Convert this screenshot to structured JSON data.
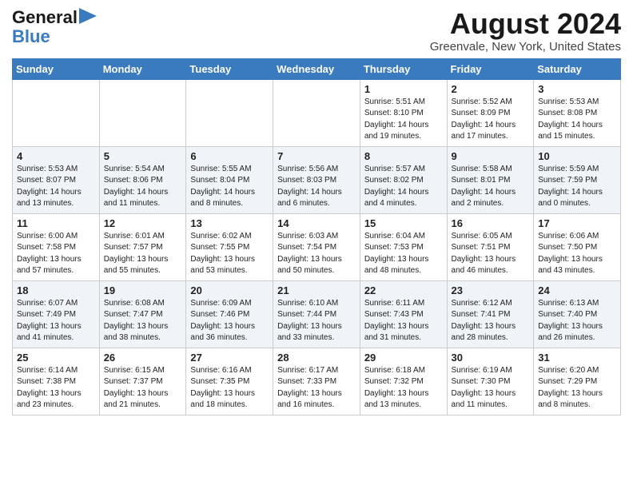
{
  "header": {
    "logo_line1": "General",
    "logo_line2": "Blue",
    "month_year": "August 2024",
    "location": "Greenvale, New York, United States"
  },
  "weekdays": [
    "Sunday",
    "Monday",
    "Tuesday",
    "Wednesday",
    "Thursday",
    "Friday",
    "Saturday"
  ],
  "weeks": [
    [
      {
        "day": "",
        "info": ""
      },
      {
        "day": "",
        "info": ""
      },
      {
        "day": "",
        "info": ""
      },
      {
        "day": "",
        "info": ""
      },
      {
        "day": "1",
        "info": "Sunrise: 5:51 AM\nSunset: 8:10 PM\nDaylight: 14 hours\nand 19 minutes."
      },
      {
        "day": "2",
        "info": "Sunrise: 5:52 AM\nSunset: 8:09 PM\nDaylight: 14 hours\nand 17 minutes."
      },
      {
        "day": "3",
        "info": "Sunrise: 5:53 AM\nSunset: 8:08 PM\nDaylight: 14 hours\nand 15 minutes."
      }
    ],
    [
      {
        "day": "4",
        "info": "Sunrise: 5:53 AM\nSunset: 8:07 PM\nDaylight: 14 hours\nand 13 minutes."
      },
      {
        "day": "5",
        "info": "Sunrise: 5:54 AM\nSunset: 8:06 PM\nDaylight: 14 hours\nand 11 minutes."
      },
      {
        "day": "6",
        "info": "Sunrise: 5:55 AM\nSunset: 8:04 PM\nDaylight: 14 hours\nand 8 minutes."
      },
      {
        "day": "7",
        "info": "Sunrise: 5:56 AM\nSunset: 8:03 PM\nDaylight: 14 hours\nand 6 minutes."
      },
      {
        "day": "8",
        "info": "Sunrise: 5:57 AM\nSunset: 8:02 PM\nDaylight: 14 hours\nand 4 minutes."
      },
      {
        "day": "9",
        "info": "Sunrise: 5:58 AM\nSunset: 8:01 PM\nDaylight: 14 hours\nand 2 minutes."
      },
      {
        "day": "10",
        "info": "Sunrise: 5:59 AM\nSunset: 7:59 PM\nDaylight: 14 hours\nand 0 minutes."
      }
    ],
    [
      {
        "day": "11",
        "info": "Sunrise: 6:00 AM\nSunset: 7:58 PM\nDaylight: 13 hours\nand 57 minutes."
      },
      {
        "day": "12",
        "info": "Sunrise: 6:01 AM\nSunset: 7:57 PM\nDaylight: 13 hours\nand 55 minutes."
      },
      {
        "day": "13",
        "info": "Sunrise: 6:02 AM\nSunset: 7:55 PM\nDaylight: 13 hours\nand 53 minutes."
      },
      {
        "day": "14",
        "info": "Sunrise: 6:03 AM\nSunset: 7:54 PM\nDaylight: 13 hours\nand 50 minutes."
      },
      {
        "day": "15",
        "info": "Sunrise: 6:04 AM\nSunset: 7:53 PM\nDaylight: 13 hours\nand 48 minutes."
      },
      {
        "day": "16",
        "info": "Sunrise: 6:05 AM\nSunset: 7:51 PM\nDaylight: 13 hours\nand 46 minutes."
      },
      {
        "day": "17",
        "info": "Sunrise: 6:06 AM\nSunset: 7:50 PM\nDaylight: 13 hours\nand 43 minutes."
      }
    ],
    [
      {
        "day": "18",
        "info": "Sunrise: 6:07 AM\nSunset: 7:49 PM\nDaylight: 13 hours\nand 41 minutes."
      },
      {
        "day": "19",
        "info": "Sunrise: 6:08 AM\nSunset: 7:47 PM\nDaylight: 13 hours\nand 38 minutes."
      },
      {
        "day": "20",
        "info": "Sunrise: 6:09 AM\nSunset: 7:46 PM\nDaylight: 13 hours\nand 36 minutes."
      },
      {
        "day": "21",
        "info": "Sunrise: 6:10 AM\nSunset: 7:44 PM\nDaylight: 13 hours\nand 33 minutes."
      },
      {
        "day": "22",
        "info": "Sunrise: 6:11 AM\nSunset: 7:43 PM\nDaylight: 13 hours\nand 31 minutes."
      },
      {
        "day": "23",
        "info": "Sunrise: 6:12 AM\nSunset: 7:41 PM\nDaylight: 13 hours\nand 28 minutes."
      },
      {
        "day": "24",
        "info": "Sunrise: 6:13 AM\nSunset: 7:40 PM\nDaylight: 13 hours\nand 26 minutes."
      }
    ],
    [
      {
        "day": "25",
        "info": "Sunrise: 6:14 AM\nSunset: 7:38 PM\nDaylight: 13 hours\nand 23 minutes."
      },
      {
        "day": "26",
        "info": "Sunrise: 6:15 AM\nSunset: 7:37 PM\nDaylight: 13 hours\nand 21 minutes."
      },
      {
        "day": "27",
        "info": "Sunrise: 6:16 AM\nSunset: 7:35 PM\nDaylight: 13 hours\nand 18 minutes."
      },
      {
        "day": "28",
        "info": "Sunrise: 6:17 AM\nSunset: 7:33 PM\nDaylight: 13 hours\nand 16 minutes."
      },
      {
        "day": "29",
        "info": "Sunrise: 6:18 AM\nSunset: 7:32 PM\nDaylight: 13 hours\nand 13 minutes."
      },
      {
        "day": "30",
        "info": "Sunrise: 6:19 AM\nSunset: 7:30 PM\nDaylight: 13 hours\nand 11 minutes."
      },
      {
        "day": "31",
        "info": "Sunrise: 6:20 AM\nSunset: 7:29 PM\nDaylight: 13 hours\nand 8 minutes."
      }
    ]
  ]
}
